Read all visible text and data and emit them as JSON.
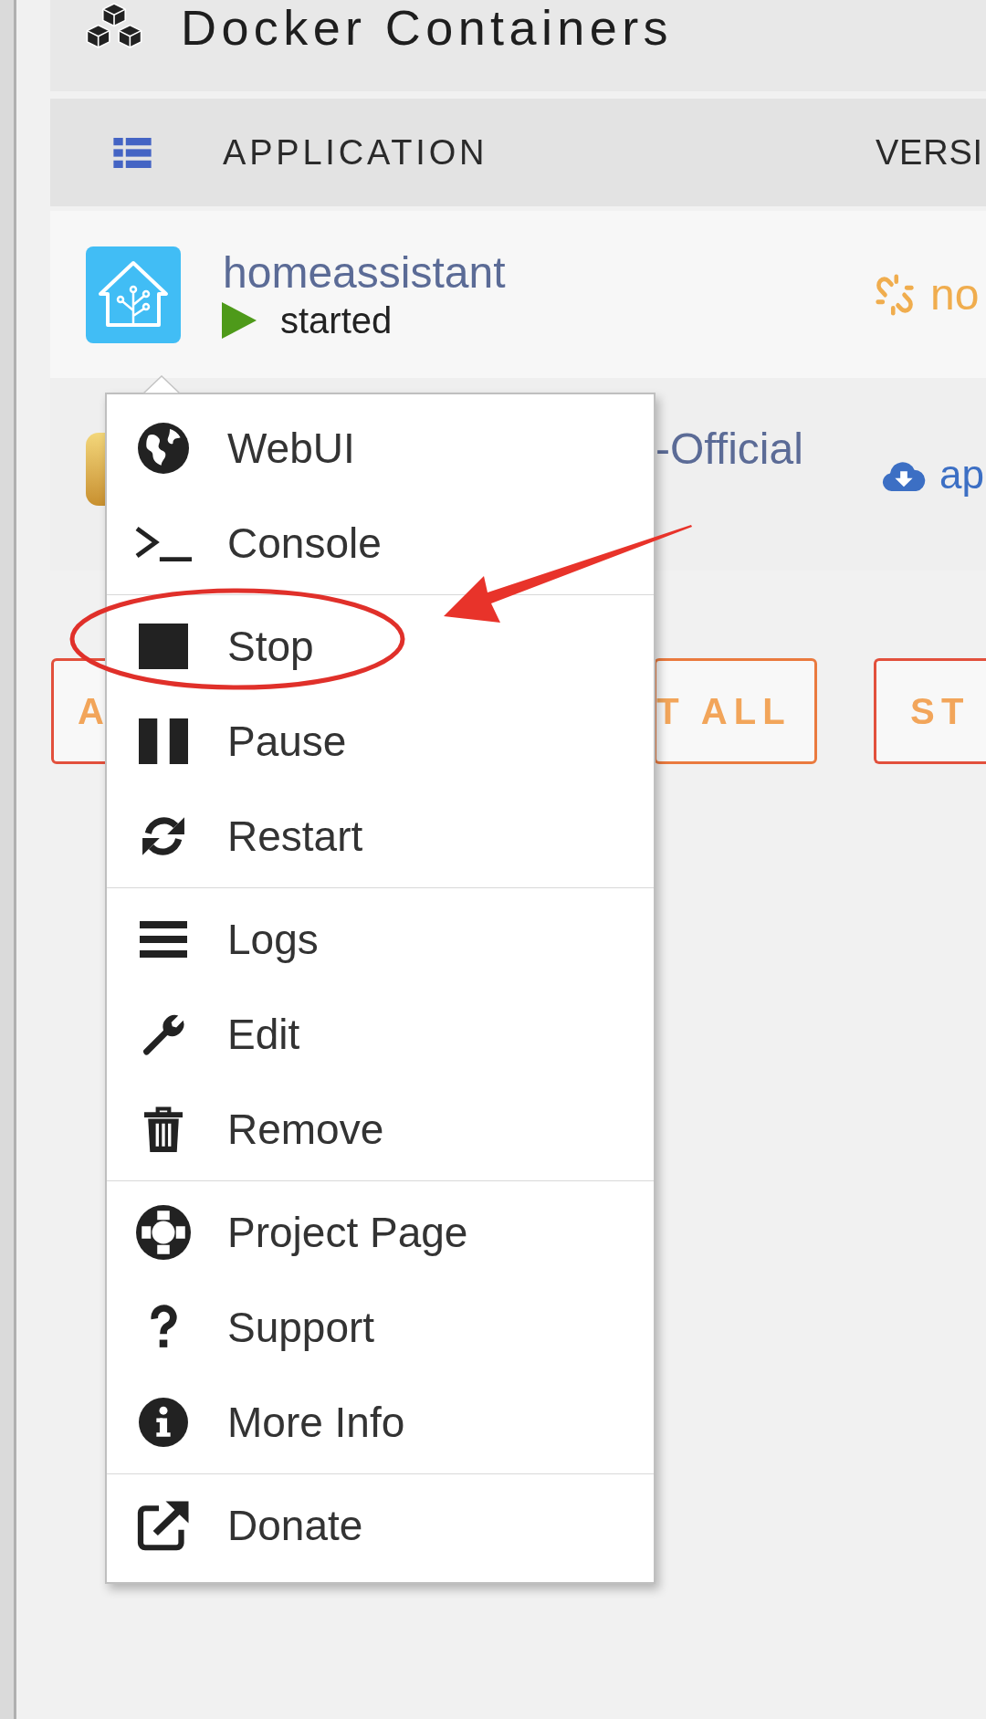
{
  "header": {
    "title": "Docker Containers"
  },
  "table": {
    "columns": [
      "APPLICATION",
      "VERSI"
    ],
    "rows": [
      {
        "name": "homeassistant",
        "status": "started",
        "running": true,
        "version": {
          "kind": "unlinked",
          "text": "no"
        }
      },
      {
        "name": "-Official",
        "version": {
          "kind": "download",
          "text": "ap"
        }
      }
    ]
  },
  "buttons": [
    {
      "label": "A"
    },
    {
      "label": "T ALL"
    },
    {
      "label": "ST"
    }
  ],
  "context_menu": {
    "groups": [
      {
        "items": [
          {
            "label": "WebUI"
          },
          {
            "label": "Console"
          }
        ]
      },
      {
        "items": [
          {
            "label": "Stop"
          },
          {
            "label": "Pause"
          },
          {
            "label": "Restart"
          }
        ]
      },
      {
        "items": [
          {
            "label": "Logs"
          },
          {
            "label": "Edit"
          },
          {
            "label": "Remove"
          }
        ]
      },
      {
        "items": [
          {
            "label": "Project Page"
          },
          {
            "label": "Support"
          },
          {
            "label": "More Info"
          }
        ]
      },
      {
        "items": [
          {
            "label": "Donate"
          }
        ]
      }
    ]
  },
  "annotations": [
    {
      "kind": "ellipse"
    },
    {
      "kind": "arrow"
    }
  ]
}
